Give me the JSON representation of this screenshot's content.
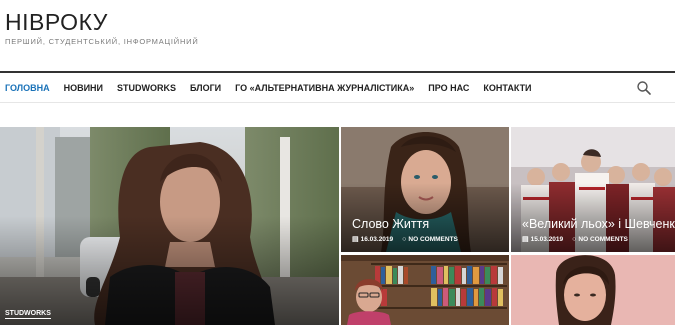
{
  "site": {
    "title": "НІВРОКУ",
    "tagline": "ПЕРШИЙ, СТУДЕНТСЬКИЙ, ІНФОРМАЦІЙНИЙ"
  },
  "nav": {
    "items": [
      "ГОЛОВНА",
      "НОВИНИ",
      "STUDWORKS",
      "БЛОГИ",
      "ГО «АЛЬТЕРНАТИВНА ЖУРНАЛІСТИКА»",
      "ПРО НАС",
      "КОНТАКТИ"
    ],
    "active_index": 0,
    "search_icon": "search-icon"
  },
  "posts": {
    "main": {
      "category": "STUDWORKS"
    },
    "post1": {
      "title": "Слово Життя",
      "date": "16.03.2019",
      "comments": "NO COMMENTS"
    },
    "post2": {
      "title": "«Великий льох» і Шевченко",
      "date": "15.03.2019",
      "comments": "NO COMMENTS"
    }
  },
  "colors": {
    "accent": "#1a72b8",
    "nav_border": "#333333",
    "text": "#222222"
  },
  "icons": {
    "date": "calendar-icon",
    "comments": "comment-icon"
  }
}
